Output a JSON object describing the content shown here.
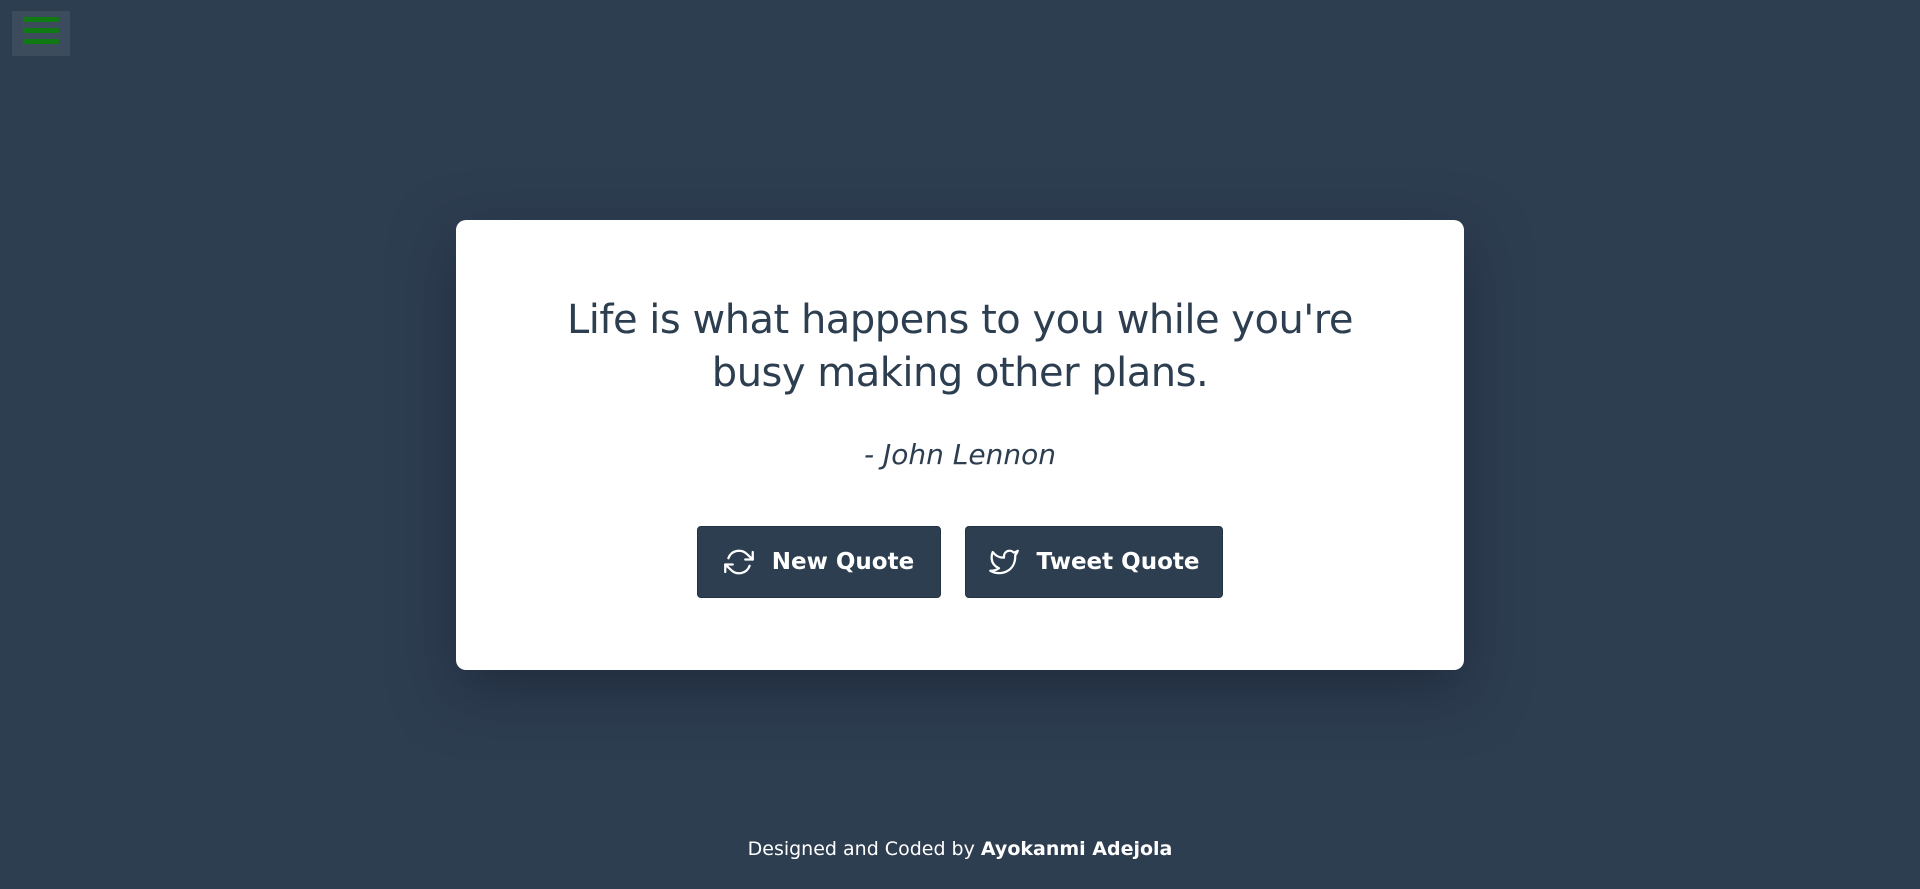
{
  "menu": {
    "icon": "hamburger-menu-icon",
    "icon_color": "#0f7a12"
  },
  "quote": {
    "text": "Life is what happens to you while you're busy making other plans.",
    "author": "- John Lennon"
  },
  "buttons": {
    "new_quote_label": "New Quote",
    "new_quote_icon": "refresh-icon",
    "tweet_quote_label": "Tweet Quote",
    "tweet_quote_icon": "twitter-bird-icon"
  },
  "footer": {
    "prefix": "Designed and Coded by",
    "name": "Ayokanmi Adejola"
  },
  "colors": {
    "background": "#2e3e51",
    "card": "#ffffff",
    "text": "#2c3e50",
    "button": "#2c3e50"
  }
}
